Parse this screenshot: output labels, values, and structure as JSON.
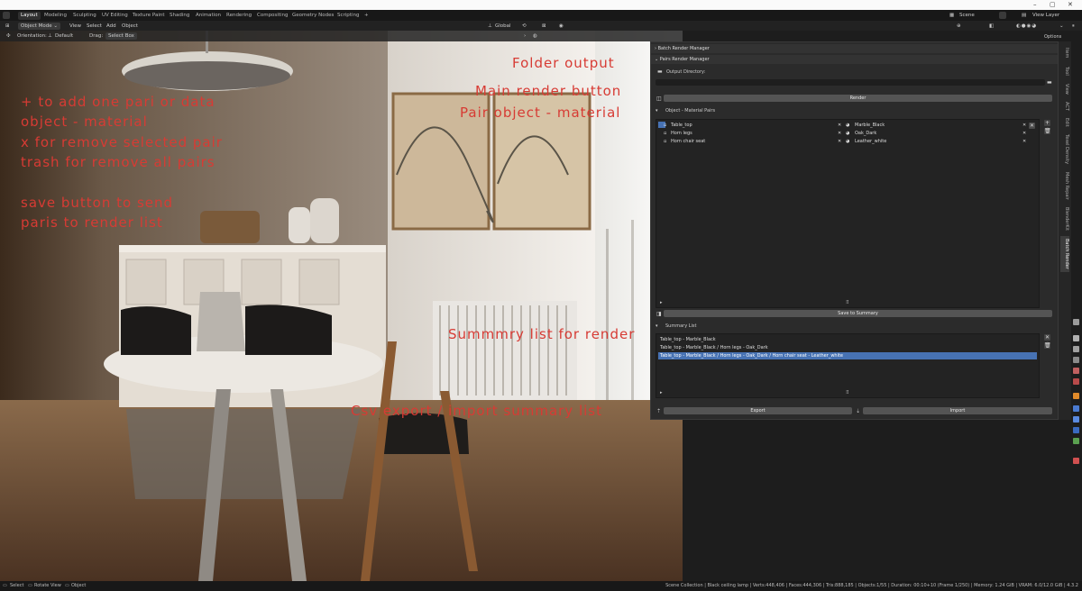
{
  "window": {
    "minimize": "–",
    "maximize": "▢",
    "close": "✕"
  },
  "workspace_tabs": [
    "Layout",
    "Modeling",
    "Sculpting",
    "UV Editing",
    "Texture Paint",
    "Shading",
    "Animation",
    "Rendering",
    "Compositing",
    "Geometry Nodes",
    "Scripting"
  ],
  "add_tab": "+",
  "header": {
    "mode": "Object Mode",
    "menus": [
      "View",
      "Select",
      "Add",
      "Object"
    ],
    "transform_orientation": "Global",
    "scene": "Scene",
    "view_layer": "View Layer",
    "options": "Options"
  },
  "tool_header": {
    "orientation_label": "Orientation:",
    "orientation_value": "Default",
    "drag_label": "Drag:",
    "drag_value": "Select Box"
  },
  "annotations": {
    "folder_output": "Folder output",
    "main_render": "Main render button",
    "pair_object": "Pair object - material",
    "help_1": "+ to add one pari or data",
    "help_2": "object - material",
    "help_3": "x for remove selected pair",
    "help_4": "trash for remove all pairs",
    "help_5": "save button to send",
    "help_6": "paris to render list",
    "summary": "Summmry list for render",
    "csv": "Csv export / import  summary list"
  },
  "panel": {
    "batch_title": "Batch Render Manager",
    "pairs_title": "Pairs Render Manager",
    "output_dir_label": "Output Directory:",
    "render_button": "Render",
    "pairs_section": "Object - Material Pairs",
    "pairs": [
      {
        "object": "Table_top",
        "material": "Marble_Black"
      },
      {
        "object": "Horn legs",
        "material": "Oak_Dark"
      },
      {
        "object": "Horn chair seat",
        "material": "Leather_white"
      }
    ],
    "save_button": "Save to Summary",
    "summary_section": "Summary List",
    "summary": [
      "Table_top - Marble_Black",
      "Table_top - Marble_Black  / Horn legs - Oak_Dark",
      "Table_top - Marble_Black  / Horn legs - Oak_Dark / Horn chair seat - Leather_white"
    ],
    "export_button": "Export",
    "import_button": "Import"
  },
  "vertical_tabs": [
    "Item",
    "Tool",
    "View",
    "ACT",
    "Edit",
    "Texel Density",
    "Mesh Repair",
    "BlenderKit",
    "Batch Render"
  ],
  "colors": {
    "annotation": "#d73b34",
    "selection": "#4772b3",
    "panel": "#2b2b2b"
  },
  "status": {
    "select": "Select",
    "rotate": "Rotate View",
    "object": "Object",
    "info": "Scene Collection | Black ceiling lamp | Verts:448,406 | Faces:444,306 | Tris:888,185 | Objects:1/55 | Duration: 00:10+10 (Frame 1/250) | Memory: 1.24 GiB | VRAM: 6.0/12.0 GiB | 4.3.2"
  }
}
